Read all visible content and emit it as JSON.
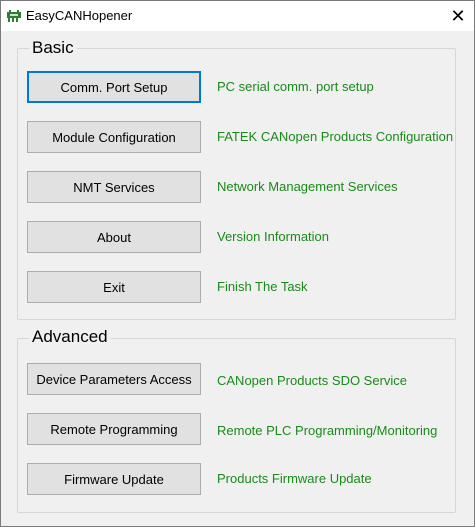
{
  "window": {
    "title": "EasyCANHopener",
    "close_glyph": "✕"
  },
  "basic": {
    "title": "Basic",
    "items": [
      {
        "button": "Comm. Port Setup",
        "description": "PC serial comm. port  setup"
      },
      {
        "button": "Module Configuration",
        "description": "FATEK CANopen Products Configuration"
      },
      {
        "button": "NMT Services",
        "description": "Network Management  Services"
      },
      {
        "button": "About",
        "description": "Version Information"
      },
      {
        "button": "Exit",
        "description": "Finish The Task"
      }
    ]
  },
  "advanced": {
    "title": "Advanced",
    "items": [
      {
        "button": "Device Parameters Access",
        "description": "CANopen Products SDO Service"
      },
      {
        "button": "Remote Programming",
        "description": "Remote PLC Programming/Monitoring"
      },
      {
        "button": "Firmware Update",
        "description": "Products Firmware Update"
      }
    ]
  },
  "colors": {
    "description_text": "#1a8a1a",
    "focus_border": "#0078d7",
    "button_face": "#e1e1e1"
  },
  "icons": {
    "app": "app-icon",
    "close": "close-icon"
  }
}
